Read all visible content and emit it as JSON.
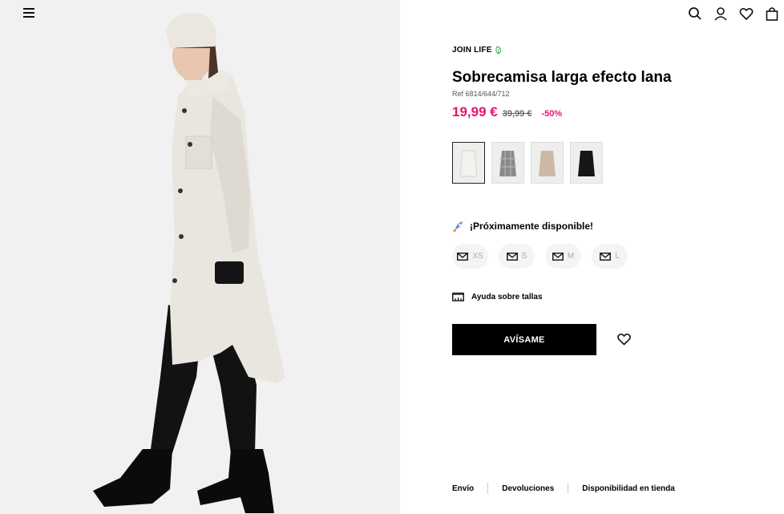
{
  "header": {
    "menu_icon": "hamburger-menu-icon",
    "icons": [
      "search-icon",
      "user-icon",
      "heart-icon",
      "bag-icon"
    ]
  },
  "product": {
    "badge": "JOIN LIFE",
    "title": "Sobrecamisa larga efecto lana",
    "ref": "Ref 6814/644/712",
    "price_current": "19,99 €",
    "price_old": "39,99 €",
    "discount": "-50%",
    "swatches": [
      "white",
      "grey-check",
      "beige",
      "black"
    ],
    "availability": "¡Próximamente disponible!",
    "sizes": [
      "XS",
      "S",
      "M",
      "L"
    ],
    "size_guide": "Ayuda sobre tallas",
    "notify_label": "AVÍSAME"
  },
  "footer": {
    "links": [
      "Envío",
      "Devoluciones",
      "Disponibilidad en tienda"
    ]
  },
  "colors": {
    "accent": "#e5146f",
    "button_bg": "#000000",
    "leaf_green": "#3aa84a"
  }
}
